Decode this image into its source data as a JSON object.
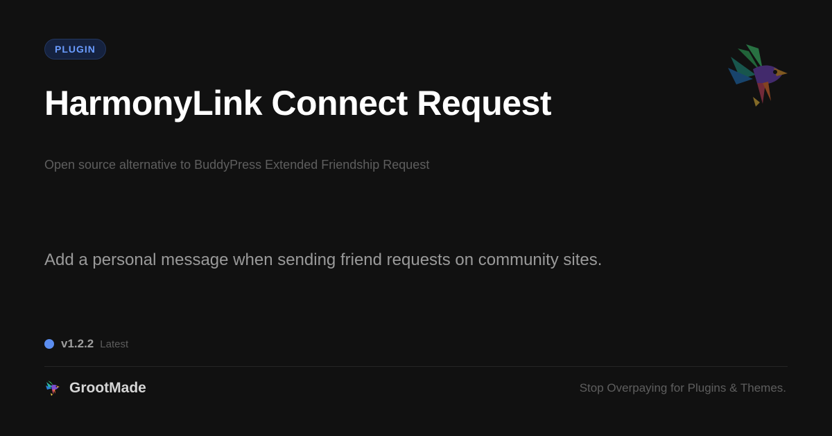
{
  "badge": {
    "label": "PLUGIN"
  },
  "title": "HarmonyLink Connect Request",
  "subtitle": "Open source alternative to BuddyPress Extended Friendship Request",
  "description": "Add a personal message when sending friend requests on community sites.",
  "version": {
    "number": "v1.2.2",
    "tag": "Latest",
    "dot_color": "#5b8def"
  },
  "brand": {
    "name": "GrootMade",
    "logo_icon": "bird-logo-icon",
    "tagline": "Stop Overpaying for Plugins & Themes."
  },
  "decoration": {
    "hero_icon": "colorful-bird-icon"
  },
  "colors": {
    "background": "#111111",
    "badge_text": "#6a9cff",
    "badge_background": "#15223f",
    "title": "#ffffff",
    "muted_text": "#5e5e5e"
  }
}
